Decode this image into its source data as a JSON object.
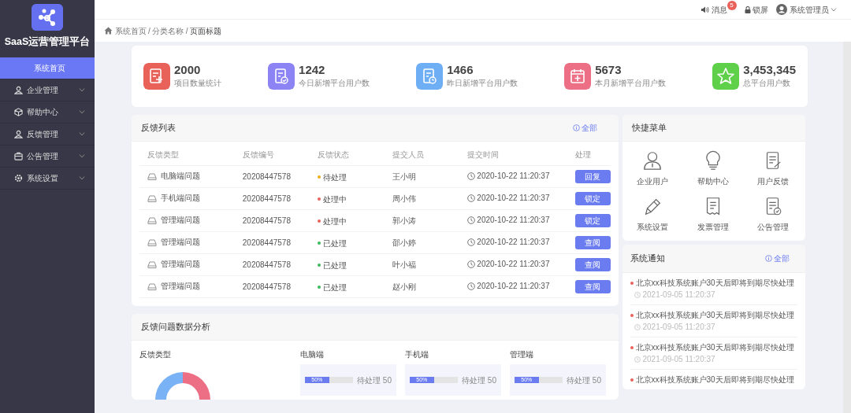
{
  "sidebar": {
    "logo_title": "SaaS运营管理平台",
    "items": [
      {
        "label": "系统首页",
        "selected": true
      },
      {
        "label": "企业管理",
        "selected": false,
        "expanded": false
      },
      {
        "label": "帮助中心",
        "selected": false,
        "expanded": false
      },
      {
        "label": "反馈管理",
        "selected": false,
        "expanded": false
      },
      {
        "label": "公告管理",
        "selected": false,
        "expanded": false
      },
      {
        "label": "系统设置",
        "selected": false,
        "expanded": false
      }
    ]
  },
  "topbar": {
    "messages": {
      "label": "消息",
      "badge": "5"
    },
    "lock": "锁屏",
    "user": "系统管理员"
  },
  "breadcrumb": {
    "separator": "/",
    "items": [
      "系统首页",
      "分类名称",
      "页面标题"
    ]
  },
  "stats": [
    {
      "value": "2000",
      "label": "项目数量统计",
      "color": "#e8625a"
    },
    {
      "value": "1242",
      "label": "今日新增平台用户数",
      "color": "#8c84f5"
    },
    {
      "value": "1466",
      "label": "昨日新增平台用户数",
      "color": "#6eaef5"
    },
    {
      "value": "5673",
      "label": "本月新增平台用户数",
      "color": "#ec6f86"
    },
    {
      "value": "3,453,345",
      "label": "总平台用户数",
      "color": "#5fd04a"
    }
  ],
  "feedback": {
    "title": "反馈列表",
    "more": "全部",
    "columns": [
      "反馈类型",
      "反馈编号",
      "反馈状态",
      "提交人员",
      "提交时间",
      "处理"
    ],
    "rows": [
      {
        "type": "电脑端问题",
        "id": "20208447578",
        "status": "待处理",
        "color": "#f0ad1a",
        "person": "王小明",
        "time": "2020-10-22 11:20:37",
        "action": "回复"
      },
      {
        "type": "手机端问题",
        "id": "20208447578",
        "status": "处理中",
        "color": "#e8625a",
        "person": "周小伟",
        "time": "2020-10-22 11:20:37",
        "action": "锁定"
      },
      {
        "type": "管理端问题",
        "id": "20208447578",
        "status": "处理中",
        "color": "#e8625a",
        "person": "郭小涛",
        "time": "2020-10-22 11:20:37",
        "action": "锁定"
      },
      {
        "type": "管理端问题",
        "id": "20208447578",
        "status": "已处理",
        "color": "#3cb95a",
        "person": "邵小婷",
        "time": "2020-10-22 11:20:37",
        "action": "查阅"
      },
      {
        "type": "管理端问题",
        "id": "20208447578",
        "status": "已处理",
        "color": "#3cb95a",
        "person": "叶小福",
        "time": "2020-10-22 11:20:37",
        "action": "查阅"
      },
      {
        "type": "管理端问题",
        "id": "20208447578",
        "status": "已处理",
        "color": "#3cb95a",
        "person": "赵小刚",
        "time": "2020-10-22 11:20:37",
        "action": "查阅"
      }
    ]
  },
  "quick_menu": {
    "title": "快捷菜单",
    "items": [
      {
        "label": "企业用户"
      },
      {
        "label": "帮助中心"
      },
      {
        "label": "用户反馈"
      },
      {
        "label": "系统设置"
      },
      {
        "label": "发票管理"
      },
      {
        "label": "公告管理"
      }
    ]
  },
  "notices": {
    "title": "系统通知",
    "more": "全部",
    "items": [
      {
        "text": "北京xx科技系统账户30天后即将到期尽快处理",
        "time": "2021-09-05 11:20:37"
      },
      {
        "text": "北京xx科技系统账户30天后即将到期尽快处理",
        "time": "2021-09-05 11:20:37"
      },
      {
        "text": "北京xx科技系统账户30天后即将到期尽快处理",
        "time": "2021-09-05 11:20:37"
      },
      {
        "text": "北京xx科技系统账户30天后即将到期尽快处理"
      }
    ]
  },
  "analysis": {
    "title": "反馈问题数据分析",
    "donut_title": "反馈类型",
    "panels": [
      {
        "title": "电脑端",
        "level": 0.5,
        "percent": "50%",
        "pending": "待处理",
        "count": "50"
      },
      {
        "title": "手机端",
        "level": 0.5,
        "percent": "50%",
        "pending": "待处理",
        "count": "50"
      },
      {
        "title": "管理端",
        "level": 0.5,
        "percent": "50%",
        "pending": "待处理",
        "count": "50"
      }
    ]
  }
}
